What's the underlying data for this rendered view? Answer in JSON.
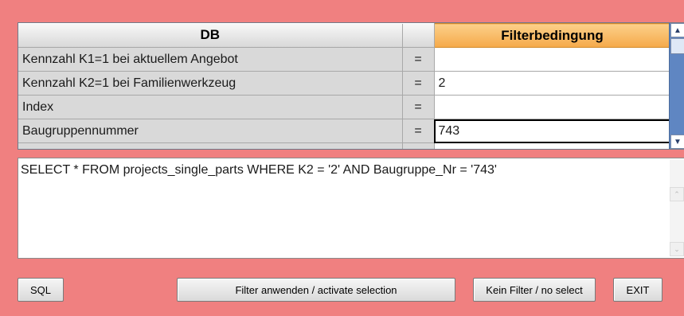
{
  "grid": {
    "headers": {
      "db": "DB",
      "eq": "",
      "filter": "Filterbedingung"
    },
    "rows": [
      {
        "field": "Kennzahl K1=1 bei aktuellem Angebot",
        "op": "=",
        "value": ""
      },
      {
        "field": "Kennzahl K2=1 bei Familienwerkzeug",
        "op": "=",
        "value": "2"
      },
      {
        "field": "Index",
        "op": "=",
        "value": ""
      },
      {
        "field": "Baugruppennummer",
        "op": "=",
        "value": "743"
      }
    ],
    "scrollbar_icons": {
      "up": "arrow-up-icon",
      "down": "arrow-down-icon"
    }
  },
  "sql": {
    "query": "SELECT * FROM projects_single_parts WHERE K2 = '2' AND Baugruppe_Nr = '743'"
  },
  "buttons": {
    "sql": "SQL",
    "apply": "Filter anwenden / activate selection",
    "clear": "Kein Filter / no select",
    "exit": "EXIT"
  },
  "colors": {
    "background": "#f08080",
    "header_active": "#f5a94a",
    "scrollbar": "#5f86c2"
  }
}
